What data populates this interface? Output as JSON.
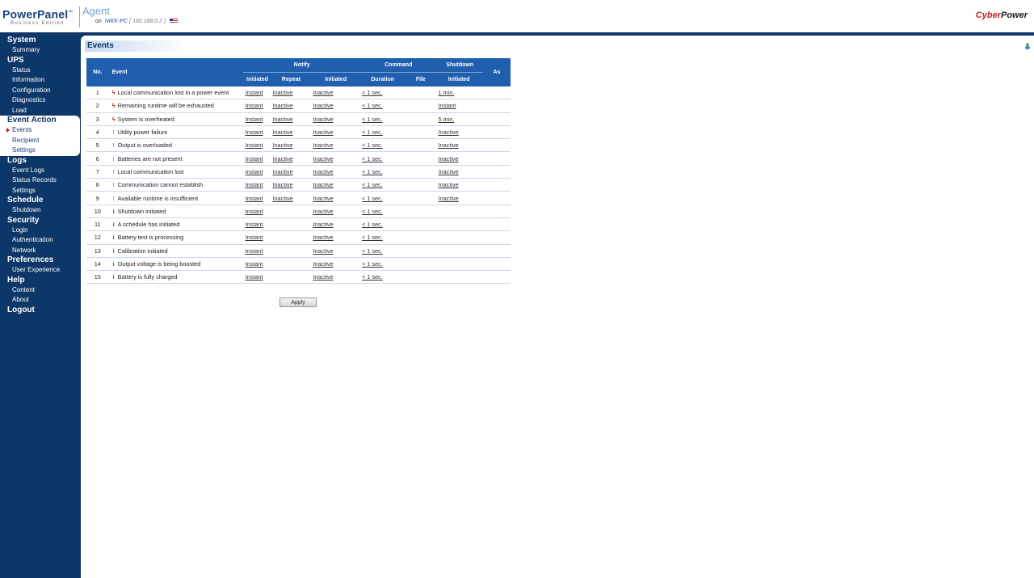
{
  "header": {
    "brand": "PowerPanel",
    "trademark": "™",
    "edition": "Business Edition",
    "app": "Agent",
    "on_label": "on",
    "host_name": "NIKK-PC",
    "host_ip": "192.168.0.2",
    "cp_logo_1": "Cyber",
    "cp_logo_2": "Power",
    "flag_icon": "us-flag-icon"
  },
  "sidebar": [
    {
      "head": "System",
      "items": [
        "Summary"
      ]
    },
    {
      "head": "UPS",
      "items": [
        "Status",
        "Information",
        "Configuration",
        "Diagnostics",
        "Load"
      ]
    },
    {
      "head": "Event Action",
      "items": [
        "Events",
        "Recipient",
        "Settings"
      ],
      "active": true,
      "selected": "Events"
    },
    {
      "head": "Logs",
      "items": [
        "Event Logs",
        "Status Records",
        "Settings"
      ]
    },
    {
      "head": "Schedule",
      "items": [
        "Shutdown"
      ]
    },
    {
      "head": "Security",
      "items": [
        "Login",
        "Authentication",
        "Network"
      ]
    },
    {
      "head": "Preferences",
      "items": [
        "User Experience"
      ]
    },
    {
      "head": "Help",
      "items": [
        "Content",
        "About"
      ]
    },
    {
      "head": "Logout",
      "items": []
    }
  ],
  "page_title": "Events",
  "table": {
    "headers": {
      "no": "No.",
      "event": "Event",
      "notify": "Notify",
      "command": "Command",
      "shutdown": "Shutdown",
      "as": "As",
      "notify_initiated": "Initiated",
      "notify_repeat": "Repeat",
      "command_initiated": "Initiated",
      "command_duration": "Duration",
      "command_file": "File",
      "shutdown_initiated": "Initiated"
    },
    "rows": [
      {
        "no": "1",
        "icon": "crit",
        "event": "Local communication lost in a power event",
        "n_init": "Instant",
        "n_rep": "Inactive",
        "c_init": "Inactive",
        "c_dur": "< 1 sec.",
        "s_init": "1 min."
      },
      {
        "no": "2",
        "icon": "crit",
        "event": "Remaining runtime will be exhausted",
        "n_init": "Instant",
        "n_rep": "Inactive",
        "c_init": "Inactive",
        "c_dur": "< 1 sec.",
        "s_init": "Instant"
      },
      {
        "no": "3",
        "icon": "crit",
        "event": "System is overheated",
        "n_init": "Instant",
        "n_rep": "Inactive",
        "c_init": "Inactive",
        "c_dur": "< 1 sec.",
        "s_init": "5 min."
      },
      {
        "no": "4",
        "icon": "warn",
        "event": "Utility power failure",
        "n_init": "Instant",
        "n_rep": "Inactive",
        "c_init": "Inactive",
        "c_dur": "< 1 sec.",
        "s_init": "Inactive"
      },
      {
        "no": "5",
        "icon": "warn",
        "event": "Output is overloaded",
        "n_init": "Instant",
        "n_rep": "Inactive",
        "c_init": "Inactive",
        "c_dur": "< 1 sec.",
        "s_init": "Inactive"
      },
      {
        "no": "6",
        "icon": "warn",
        "event": "Batteries are not present",
        "n_init": "Instant",
        "n_rep": "Inactive",
        "c_init": "Inactive",
        "c_dur": "< 1 sec.",
        "s_init": "Inactive"
      },
      {
        "no": "7",
        "icon": "warn",
        "event": "Local communication lost",
        "n_init": "Instant",
        "n_rep": "Inactive",
        "c_init": "Inactive",
        "c_dur": "< 1 sec.",
        "s_init": "Inactive"
      },
      {
        "no": "8",
        "icon": "warn",
        "event": "Communication cannot establish",
        "n_init": "Instant",
        "n_rep": "Inactive",
        "c_init": "Inactive",
        "c_dur": "< 1 sec.",
        "s_init": "Inactive"
      },
      {
        "no": "9",
        "icon": "warn",
        "event": "Available runtime is insufficient",
        "n_init": "Instant",
        "n_rep": "Inactive",
        "c_init": "Inactive",
        "c_dur": "< 1 sec.",
        "s_init": "Inactive"
      },
      {
        "no": "10",
        "icon": "info",
        "event": "Shutdown initiated",
        "n_init": "Instant",
        "n_rep": "",
        "c_init": "Inactive",
        "c_dur": "< 1 sec.",
        "s_init": ""
      },
      {
        "no": "11",
        "icon": "info",
        "event": "A schedule has initiated",
        "n_init": "Instant",
        "n_rep": "",
        "c_init": "Inactive",
        "c_dur": "< 1 sec.",
        "s_init": ""
      },
      {
        "no": "12",
        "icon": "info",
        "event": "Battery test is processing",
        "n_init": "Instant",
        "n_rep": "",
        "c_init": "Inactive",
        "c_dur": "< 1 sec.",
        "s_init": ""
      },
      {
        "no": "13",
        "icon": "info",
        "event": "Calibration initiated",
        "n_init": "Instant",
        "n_rep": "",
        "c_init": "Inactive",
        "c_dur": "< 1 sec.",
        "s_init": ""
      },
      {
        "no": "14",
        "icon": "info",
        "event": "Output voltage is being boosted",
        "n_init": "Instant",
        "n_rep": "",
        "c_init": "Inactive",
        "c_dur": "< 1 sec.",
        "s_init": ""
      },
      {
        "no": "15",
        "icon": "info",
        "event": "Battery is fully charged",
        "n_init": "Instant",
        "n_rep": "",
        "c_init": "Inactive",
        "c_dur": "< 1 sec.",
        "s_init": ""
      }
    ]
  },
  "apply_label": "Apply",
  "icons": {
    "crit": "lightning-icon",
    "warn": "exclamation-icon",
    "info": "info-icon"
  },
  "colors": {
    "navy": "#0d3768",
    "header_blue": "#1f5fae",
    "critical": "#c01616",
    "warning": "#e29a00",
    "info": "#1f5fae"
  }
}
